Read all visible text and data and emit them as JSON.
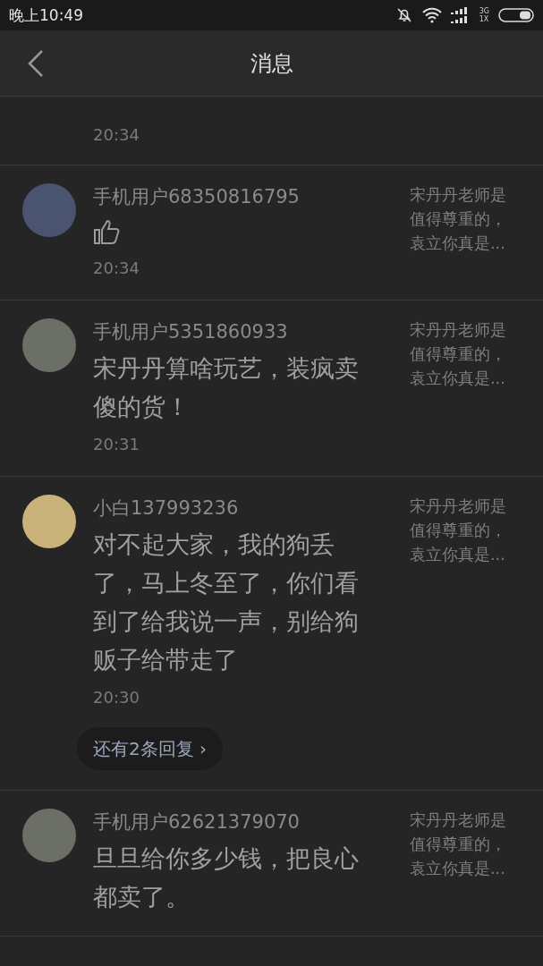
{
  "status_bar": {
    "time": "晚上10:49",
    "network_top": "3G",
    "network_bottom": "1X"
  },
  "header": {
    "title": "消息"
  },
  "messages": [
    {
      "time": "20:34"
    },
    {
      "user": "手机用户68350816795",
      "kind": "thumbs_up",
      "time": "20:34",
      "quote": "宋丹丹老师是值得尊重的，袁立你真是..."
    },
    {
      "user": "手机用户5351860933",
      "kind": "text",
      "text": "宋丹丹算啥玩艺，装疯卖傻的货！",
      "time": "20:31",
      "quote": "宋丹丹老师是值得尊重的，袁立你真是..."
    },
    {
      "user": "小白137993236",
      "kind": "text",
      "text": "对不起大家，我的狗丢了，马上冬至了，你们看到了给我说一声，别给狗贩子给带走了",
      "time": "20:30",
      "replies": "还有2条回复 ›",
      "quote": "宋丹丹老师是值得尊重的，袁立你真是..."
    },
    {
      "user": "手机用户62621379070",
      "kind": "text",
      "text": "旦旦给你多少钱，把良心都卖了。",
      "quote": "宋丹丹老师是值得尊重的，袁立你真是..."
    }
  ]
}
